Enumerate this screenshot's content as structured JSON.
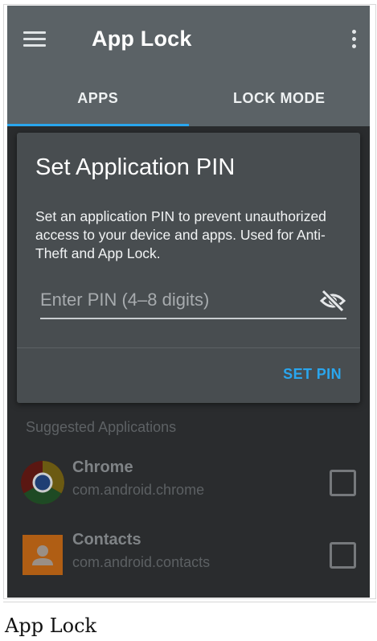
{
  "app_bar": {
    "title": "App Lock",
    "menu_icon": "hamburger-menu-icon",
    "overflow_icon": "more-vert-icon"
  },
  "tabs": [
    {
      "label": "APPS",
      "active": true
    },
    {
      "label": "LOCK MODE",
      "active": false
    }
  ],
  "dialog": {
    "title": "Set Application PIN",
    "message": "Set an application PIN to prevent unauthorized access to your device and apps. Used for Anti-Theft and App Lock.",
    "pin_input": {
      "value": "",
      "placeholder": "Enter PIN (4–8 digits)"
    },
    "visibility_icon": "visibility-off-icon",
    "set_pin_label": "SET PIN"
  },
  "list": {
    "header": "Suggested Applications",
    "apps": [
      {
        "name": "Chrome",
        "package": "com.android.chrome",
        "icon": "chrome-icon",
        "checked": false
      },
      {
        "name": "Contacts",
        "package": "com.android.contacts",
        "icon": "contacts-icon",
        "checked": false
      }
    ]
  },
  "caption": "App Lock",
  "colors": {
    "app_bar": "#5b6266",
    "accent": "#2aa6ee",
    "dialog": "#484d50",
    "background": "#2a2c2e"
  }
}
